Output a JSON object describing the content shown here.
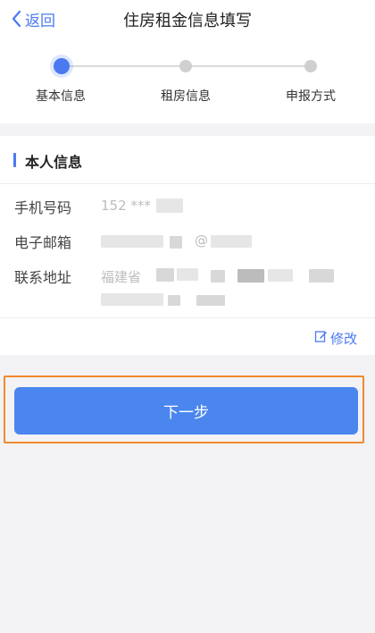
{
  "header": {
    "back_label": "返回",
    "title": "住房租金信息填写"
  },
  "stepper": {
    "steps": [
      "基本信息",
      "租房信息",
      "申报方式"
    ],
    "current_step": 1
  },
  "personal_info": {
    "section_title": "本人信息",
    "phone": {
      "label": "手机号码",
      "value": "152 ***"
    },
    "email": {
      "label": "电子邮箱",
      "value": "@"
    },
    "address": {
      "label": "联系地址",
      "value": "福建省"
    }
  },
  "actions": {
    "edit_label": "修改",
    "next_label": "下一步"
  },
  "colors": {
    "accent": "#4a79f0",
    "button": "#4a86ee",
    "highlight": "#f0892c",
    "background": "#f3f3f5"
  }
}
